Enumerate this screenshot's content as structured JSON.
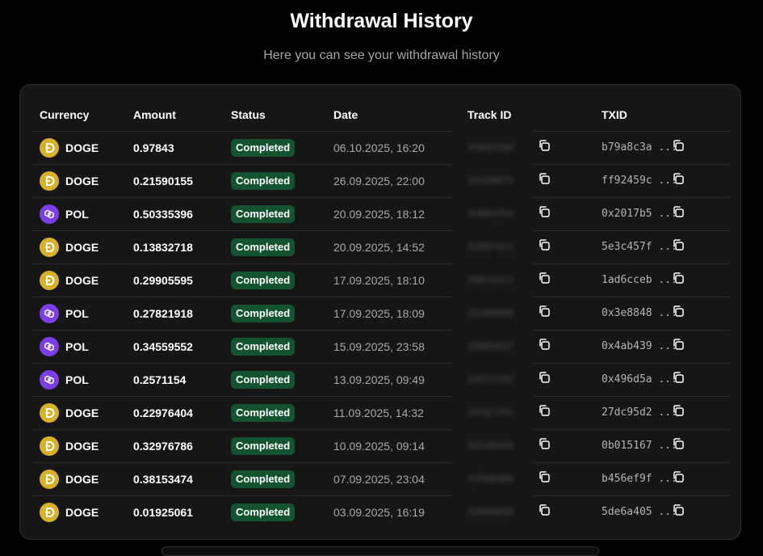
{
  "header": {
    "title": "Withdrawal History",
    "subtitle": "Here you can see your withdrawal history"
  },
  "table": {
    "columns": {
      "currency": "Currency",
      "amount": "Amount",
      "status": "Status",
      "date": "Date",
      "track_id": "Track ID",
      "txid": "TXID"
    },
    "rows": [
      {
        "currency": "DOGE",
        "amount": "0.97843",
        "status": "Completed",
        "date": "06.10.2025, 16:20",
        "track_id": "35042109",
        "txid": "b79a8c3a ..."
      },
      {
        "currency": "DOGE",
        "amount": "0.21590155",
        "status": "Completed",
        "date": "26.09.2025, 22:00",
        "track_id": "35168873",
        "txid": "ff92459c ..."
      },
      {
        "currency": "POL",
        "amount": "0.50335396",
        "status": "Completed",
        "date": "20.09.2025, 18:12",
        "track_id": "33801354",
        "txid": "0x2017b5 ..."
      },
      {
        "currency": "DOGE",
        "amount": "0.13832718",
        "status": "Completed",
        "date": "20.09.2025, 14:52",
        "track_id": "31897411",
        "txid": "5e3c457f ..."
      },
      {
        "currency": "DOGE",
        "amount": "0.29905595",
        "status": "Completed",
        "date": "17.09.2025, 18:10",
        "track_id": "29874321",
        "txid": "1ad6cceb ..."
      },
      {
        "currency": "POL",
        "amount": "0.27821918",
        "status": "Completed",
        "date": "17.09.2025, 18:09",
        "track_id": "25490088",
        "txid": "0x3e8848 ..."
      },
      {
        "currency": "POL",
        "amount": "0.34559552",
        "status": "Completed",
        "date": "15.09.2025, 23:58",
        "track_id": "25664437",
        "txid": "0x4ab439 ..."
      },
      {
        "currency": "POL",
        "amount": "0.2571154",
        "status": "Completed",
        "date": "13.09.2025, 09:49",
        "track_id": "22671182",
        "txid": "0x496d5a ..."
      },
      {
        "currency": "DOGE",
        "amount": "0.22976404",
        "status": "Completed",
        "date": "11.09.2025, 14:32",
        "track_id": "25367755",
        "txid": "27dc95d2 ..."
      },
      {
        "currency": "DOGE",
        "amount": "0.32976786",
        "status": "Completed",
        "date": "10.09.2025, 09:14",
        "track_id": "28120324",
        "txid": "0b015167 ..."
      },
      {
        "currency": "DOGE",
        "amount": "0.38153474",
        "status": "Completed",
        "date": "07.09.2025, 23:04",
        "track_id": "22590384",
        "txid": "b456ef9f ..."
      },
      {
        "currency": "DOGE",
        "amount": "0.01925061",
        "status": "Completed",
        "date": "03.09.2025, 16:19",
        "track_id": "22800650",
        "txid": "5de6a405 ..."
      }
    ]
  },
  "icons": {
    "DOGE": "doge-coin-icon",
    "POL": "pol-coin-icon",
    "copy": "copy-icon"
  },
  "colors": {
    "doge": "#d8b12a",
    "pol": "#7b3fe4",
    "badge_bg": "#13532f",
    "card_bg": "#161616"
  }
}
